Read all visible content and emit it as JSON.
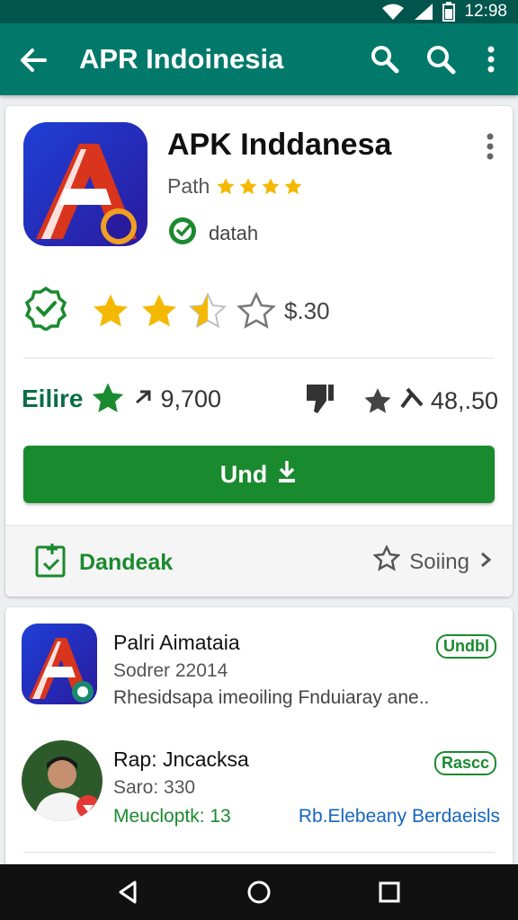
{
  "status_bar": {
    "time": "12:98",
    "wifi_icon": "wifi-icon",
    "signal_icon": "signal-icon",
    "battery_icon": "battery-icon"
  },
  "app_bar": {
    "title": "APR Indoinesia",
    "icons": [
      "back-arrow-icon",
      "search-icon",
      "search-icon",
      "more-vert-icon"
    ]
  },
  "app": {
    "title": "APK Inddanesa",
    "developer": "Path",
    "developer_stars": 4,
    "status_label": "datah",
    "rating_price": "$.30",
    "rating_value": 2.5,
    "stats_label": "Eilire",
    "stats_downloads": "9,700",
    "stats_reviews": "48,.50",
    "install_label": "Und",
    "footer_left_label": "Dandeak",
    "footer_right_label": "Soiing"
  },
  "related": [
    {
      "title": "Palri Aimataia",
      "subtitle": "Sodrer 22014",
      "description": "Rhesidsapa imeoiling Fnduiaray ane..",
      "badge": "Undbl"
    },
    {
      "title": "Rap: Jncacksa",
      "subtitle": "Saro: 330",
      "meta_left": "Meucloptk: 13",
      "meta_right": "Rb.Elebeany Berdaeisls",
      "badge": "Rascc"
    }
  ],
  "colors": {
    "app_bar": "#00796b",
    "status_bar": "#00554d",
    "accent_green": "#1a8a2e",
    "star_gold": "#f5b800"
  }
}
